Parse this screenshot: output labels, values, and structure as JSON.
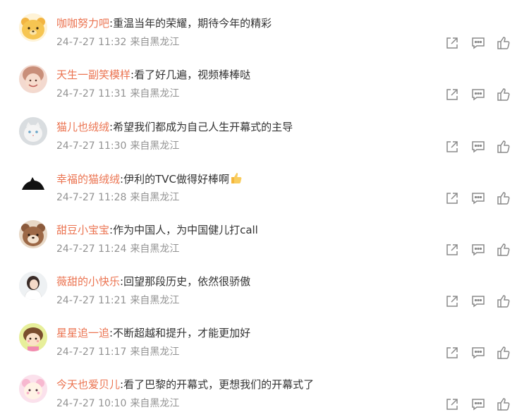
{
  "comments": [
    {
      "avatar_icon": "yellow-bear-avatar",
      "username": "咖咖努力吧",
      "text": ":重温当年的荣耀，期待今年的精彩",
      "date": "24-7-27 11:32",
      "source": "来自黑龙江"
    },
    {
      "avatar_icon": "smiling-person-avatar",
      "username": "天生一副笑模样",
      "text": ":看了好几遍，视频棒棒哒",
      "date": "24-7-27 11:31",
      "source": "来自黑龙江"
    },
    {
      "avatar_icon": "cat-photo-avatar",
      "username": "猫儿也绒绒",
      "text": ":希望我们都成为自己人生开幕式的主导",
      "date": "24-7-27 11:30",
      "source": "来自黑龙江"
    },
    {
      "avatar_icon": "black-cat-silhouette-avatar",
      "username": "幸福的猫绒绒",
      "text": ":伊利的TVC做得好棒啊",
      "emoji": "thumbs-up-emoji",
      "date": "24-7-27 11:28",
      "source": "来自黑龙江"
    },
    {
      "avatar_icon": "brown-bear-avatar",
      "username": "甜豆小宝宝",
      "text": ":作为中国人，为中国健儿打call",
      "date": "24-7-27 11:24",
      "source": "来自黑龙江"
    },
    {
      "avatar_icon": "girl-portrait-avatar",
      "username": "薇甜的小快乐",
      "text": ":回望那段历史，依然很骄傲",
      "date": "24-7-27 11:21",
      "source": "来自黑龙江"
    },
    {
      "avatar_icon": "cartoon-girl-avatar",
      "username": "星星追一追",
      "text": ":不断超越和提升，才能更加好",
      "date": "24-7-27 11:17",
      "source": "来自黑龙江"
    },
    {
      "avatar_icon": "pink-cartoon-avatar",
      "username": "今天也爱贝儿",
      "text": ":看了巴黎的开幕式，更想我们的开幕式了",
      "date": "24-7-27 10:10",
      "source": "来自黑龙江"
    }
  ],
  "action_icons": [
    "share-icon",
    "comment-icon",
    "like-icon"
  ],
  "colors": {
    "username": "#eb7350",
    "text": "#333333",
    "meta": "#939393",
    "icon": "#8a8a8a"
  }
}
